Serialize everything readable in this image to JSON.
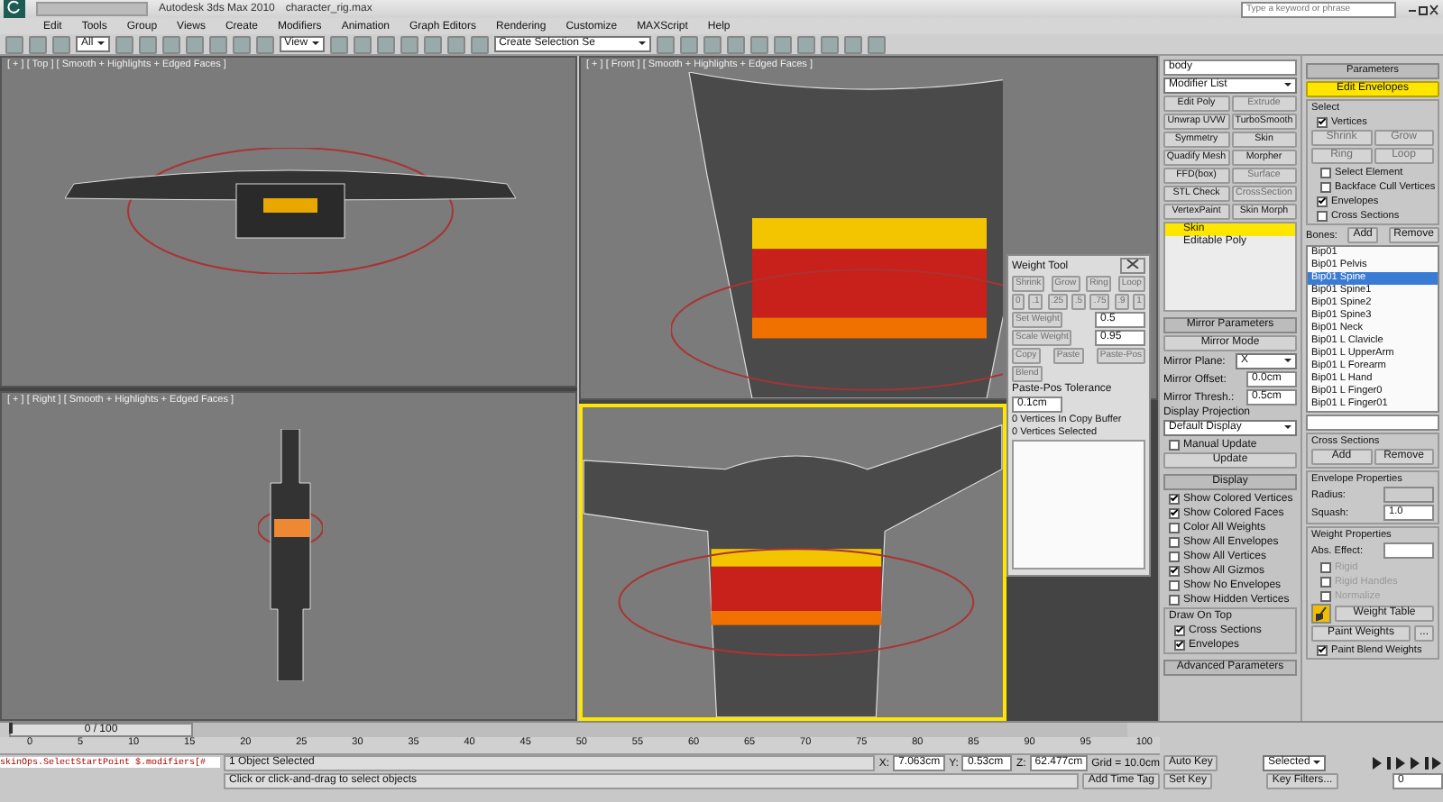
{
  "title_bar": {
    "app_title": "Autodesk 3ds Max 2010",
    "file_name": "character_rig.max",
    "search_placeholder": "Type a keyword or phrase"
  },
  "menu": [
    "Edit",
    "Tools",
    "Group",
    "Views",
    "Create",
    "Modifiers",
    "Animation",
    "Graph Editors",
    "Rendering",
    "Customize",
    "MAXScript",
    "Help"
  ],
  "toolbar": {
    "selection_filter": "All",
    "reference_coord": "View",
    "named_selection": "Create Selection Se"
  },
  "viewports": [
    {
      "label": "[ + ] [ Top ] [ Smooth + Highlights + Edged Faces ]",
      "kind": "top",
      "active": false
    },
    {
      "label": "[ + ] [ Front ] [ Smooth + Highlights + Edged Faces ]",
      "kind": "front",
      "active": false
    },
    {
      "label": "[ + ] [ Right ] [ Smooth + Highlights + Edged Faces ]",
      "kind": "side",
      "active": false
    },
    {
      "kind": "perspective",
      "active": true
    }
  ],
  "weight_tool": {
    "title": "Weight Tool",
    "select_buttons": [
      "Shrink",
      "Grow",
      "Ring",
      "Loop"
    ],
    "presets": [
      "0",
      ".1",
      ".25",
      ".5",
      ".75",
      ".9",
      "1"
    ],
    "set_weight": "Set Weight",
    "set_weight_value": "0.5",
    "scale_weight": "Scale Weight",
    "scale_weight_value": "0.95",
    "copy_buttons": [
      "Copy",
      "Paste",
      "Paste-Pos",
      "Blend"
    ],
    "tolerance_label": "Paste-Pos Tolerance",
    "tolerance_value": "0.1cm",
    "buffer_info": "0 Vertices In Copy Buffer",
    "selected_info": "0 Vertices Selected"
  },
  "command_panel": {
    "object_name": "body",
    "modifier_list": "Modifier List",
    "modifier_buttons": [
      {
        "label": "Edit Poly",
        "disabled": false
      },
      {
        "label": "Extrude",
        "disabled": true
      },
      {
        "label": "Unwrap UVW",
        "disabled": false
      },
      {
        "label": "TurboSmooth",
        "disabled": false
      },
      {
        "label": "Symmetry",
        "disabled": false
      },
      {
        "label": "Skin",
        "disabled": false
      },
      {
        "label": "Quadify Mesh",
        "disabled": false
      },
      {
        "label": "Morpher",
        "disabled": false
      },
      {
        "label": "FFD(box)",
        "disabled": false
      },
      {
        "label": "Surface",
        "disabled": true
      },
      {
        "label": "STL Check",
        "disabled": false
      },
      {
        "label": "CrossSection",
        "disabled": true
      },
      {
        "label": "VertexPaint",
        "disabled": false
      },
      {
        "label": "Skin Morph",
        "disabled": false
      }
    ],
    "stack": [
      {
        "label": "Skin",
        "selected": true
      },
      {
        "label": "Editable Poly",
        "selected": false
      }
    ],
    "mirror": {
      "title": "Mirror Parameters",
      "mode_button": "Mirror Mode",
      "plane_label": "Mirror Plane:",
      "plane_value": "X",
      "offset_label": "Mirror Offset:",
      "offset_value": "0.0cm",
      "thresh_label": "Mirror Thresh.:",
      "thresh_value": "0.5cm",
      "projection_label": "Display Projection",
      "projection_value": "Default Display",
      "manual_update": {
        "label": "Manual Update",
        "checked": false
      },
      "update_button": "Update"
    },
    "display": {
      "title": "Display",
      "options": [
        {
          "label": "Show Colored Vertices",
          "checked": true
        },
        {
          "label": "Show Colored Faces",
          "checked": true
        },
        {
          "label": "Color All Weights",
          "checked": false
        },
        {
          "label": "Show All Envelopes",
          "checked": false
        },
        {
          "label": "Show All Vertices",
          "checked": false
        },
        {
          "label": "Show All Gizmos",
          "checked": true
        },
        {
          "label": "Show No Envelopes",
          "checked": false
        },
        {
          "label": "Show Hidden Vertices",
          "checked": false
        }
      ],
      "draw_on_top_title": "Draw On Top",
      "draw_on_top": [
        {
          "label": "Cross Sections",
          "checked": true
        },
        {
          "label": "Envelopes",
          "checked": true
        }
      ]
    },
    "advanced_title": "Advanced Parameters"
  },
  "skin_parameters": {
    "title": "Parameters",
    "edit_envelopes": {
      "label": "Edit Envelopes",
      "selected": true
    },
    "select_title": "Select",
    "vertices": {
      "label": "Vertices",
      "checked": true
    },
    "select_buttons": [
      "Shrink",
      "Grow",
      "Ring",
      "Loop"
    ],
    "select_options": [
      {
        "label": "Select Element",
        "checked": false
      },
      {
        "label": "Backface Cull Vertices",
        "checked": false
      }
    ],
    "filters": [
      {
        "label": "Envelopes",
        "checked": true
      },
      {
        "label": "Cross Sections",
        "checked": false
      }
    ],
    "bones_label": "Bones:",
    "bones_add": "Add",
    "bones_remove": "Remove",
    "bones": [
      {
        "label": "Bip01",
        "selected": false
      },
      {
        "label": "Bip01 Pelvis",
        "selected": false
      },
      {
        "label": "Bip01 Spine",
        "selected": true
      },
      {
        "label": "Bip01 Spine1",
        "selected": false
      },
      {
        "label": "Bip01 Spine2",
        "selected": false
      },
      {
        "label": "Bip01 Spine3",
        "selected": false
      },
      {
        "label": "Bip01 Neck",
        "selected": false
      },
      {
        "label": "Bip01 L Clavicle",
        "selected": false
      },
      {
        "label": "Bip01 L UpperArm",
        "selected": false
      },
      {
        "label": "Bip01 L Forearm",
        "selected": false
      },
      {
        "label": "Bip01 L Hand",
        "selected": false
      },
      {
        "label": "Bip01 L Finger0",
        "selected": false
      },
      {
        "label": "Bip01 L Finger01",
        "selected": false
      }
    ],
    "cross_sections_title": "Cross Sections",
    "cs_add": "Add",
    "cs_remove": "Remove",
    "envelope_title": "Envelope Properties",
    "radius_label": "Radius:",
    "squash_label": "Squash:",
    "squash_value": "1.0",
    "weight_title": "Weight Properties",
    "abs_effect_label": "Abs. Effect:",
    "weight_options": [
      {
        "label": "Rigid",
        "checked": false
      },
      {
        "label": "Rigid Handles",
        "checked": false
      },
      {
        "label": "Normalize",
        "checked": false
      }
    ],
    "weight_table": "Weight Table",
    "paint_weights": "Paint Weights",
    "paint_options": "...",
    "paint_blend": {
      "label": "Paint Blend Weights",
      "checked": true
    }
  },
  "timeline": {
    "slider": "0 / 100",
    "level": 0,
    "ticks": [
      "0",
      "5",
      "10",
      "15",
      "20",
      "25",
      "30",
      "35",
      "40",
      "45",
      "50",
      "55",
      "60",
      "65",
      "70",
      "75",
      "80",
      "85",
      "90",
      "95",
      "100"
    ]
  },
  "status_bar": {
    "script_line": "skinOps.SelectStartPoint $.modifiers[#",
    "selection": "1 Object Selected",
    "prompt": "Click or click-and-drag to select objects",
    "x_label": "X:",
    "x": "7.063cm",
    "y_label": "Y:",
    "y": "0.53cm",
    "z_label": "Z:",
    "z": "62.477cm",
    "grid": "Grid = 10.0cm",
    "auto_key": "Auto Key",
    "key_mode": "Selected",
    "set_key": "Set Key",
    "key_filters": "Key Filters...",
    "frame": "0",
    "time_tag": "Add Time Tag"
  }
}
